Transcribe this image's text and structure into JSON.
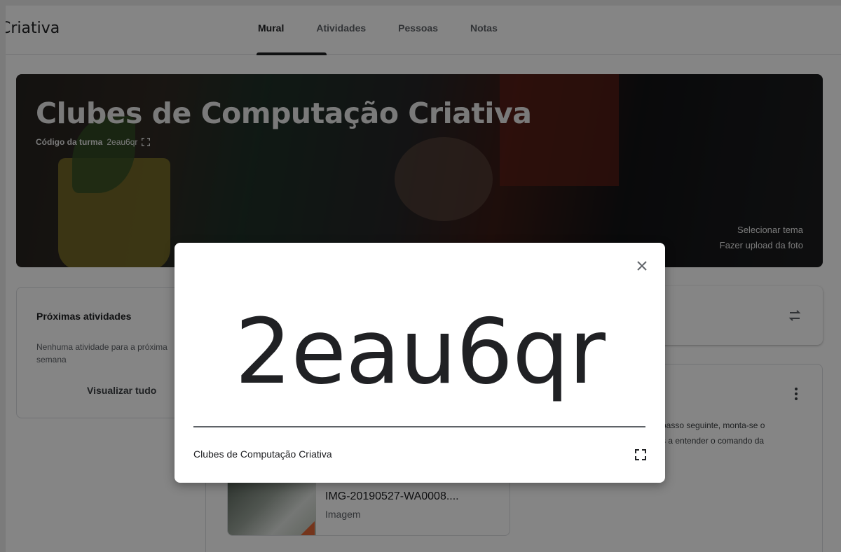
{
  "app": {
    "title": "Criativa"
  },
  "tabs": [
    {
      "label": "Mural",
      "active": true
    },
    {
      "label": "Atividades",
      "active": false
    },
    {
      "label": "Pessoas",
      "active": false
    },
    {
      "label": "Notas",
      "active": false
    }
  ],
  "banner": {
    "title": "Clubes de Computação Criativa",
    "code_label": "Código da turma",
    "code_value": "2eau6qr",
    "select_theme": "Selecionar tema",
    "upload_photo": "Fazer upload da foto"
  },
  "upcoming": {
    "title": "Próximas atividades",
    "empty_text": "Nenhuma atividade para a próxima semana",
    "view_all": "Visualizar tudo"
  },
  "post": {
    "text_line1": "passo seguinte, monta-se o",
    "text_line2": "s a entender o comando da",
    "attachment": {
      "name": "IMG-20190527-WA0008....",
      "type": "Imagem"
    }
  },
  "dialog": {
    "code": "2eau6qr",
    "class_name": "Clubes de Computação Criativa"
  },
  "colors": {
    "overlay": "#000000",
    "text_primary": "#202124",
    "divider": "#5f6368"
  }
}
